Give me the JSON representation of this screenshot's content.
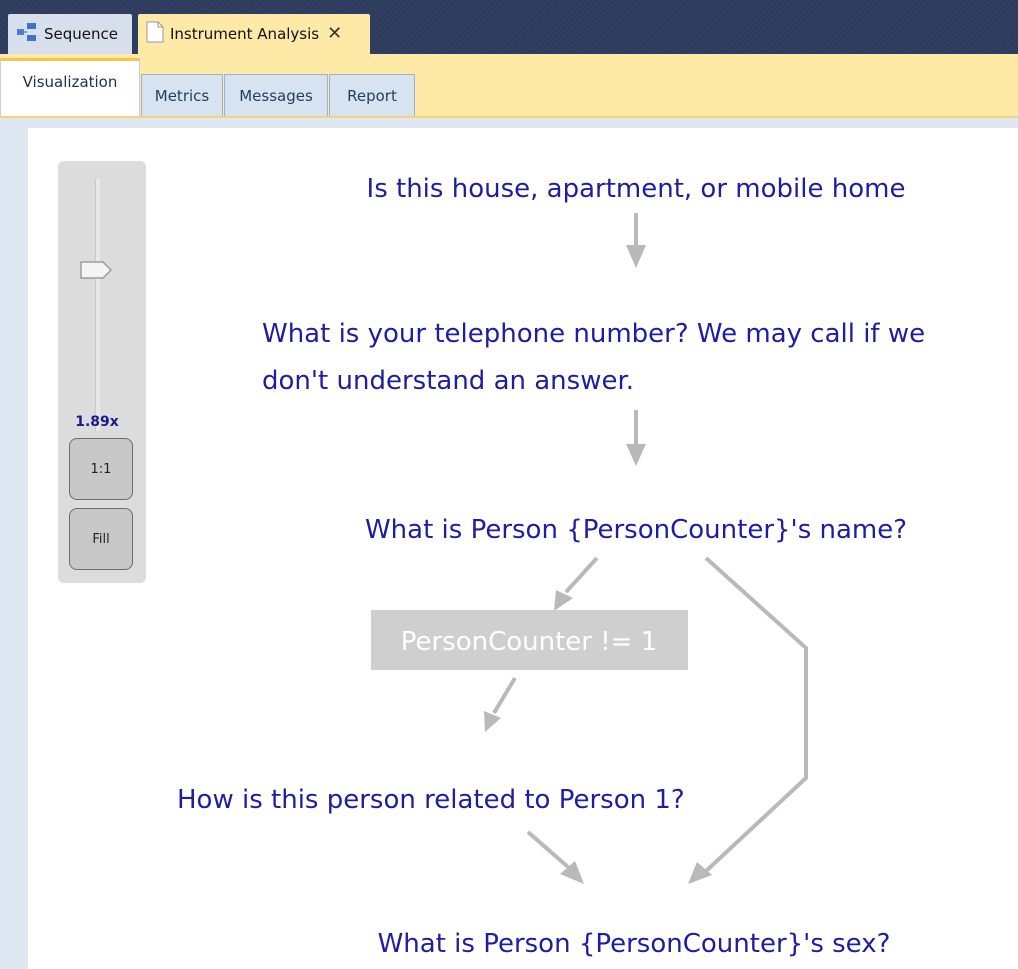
{
  "doc_tabs": [
    {
      "label": "Sequence",
      "icon": "sequence-icon",
      "active": false
    },
    {
      "label": "Instrument Analysis",
      "icon": "document-icon",
      "active": true
    }
  ],
  "view_tabs": [
    {
      "label": "Visualization",
      "active": true
    },
    {
      "label": "Metrics",
      "active": false
    },
    {
      "label": "Messages",
      "active": false
    },
    {
      "label": "Report",
      "active": false
    }
  ],
  "zoom": {
    "readout": "1.89x",
    "one_to_one_label": "1:1",
    "fill_label": "Fill"
  },
  "flow": {
    "q1": "Is this house, apartment, or mobile home",
    "q2_line1": "What is your telephone number? We may call if we",
    "q2_line2": "don't understand an answer.",
    "q3": "What is Person {PersonCounter}'s name?",
    "condition": "PersonCounter != 1",
    "q4": "How is this person related to Person 1?",
    "q5": "What is Person {PersonCounter}'s sex?"
  },
  "colors": {
    "question_text": "#1e1ea0",
    "arrow": "#b9b9b9",
    "active_tab": "#ffe9a6",
    "tabbar_bg": "#2d3b5e"
  }
}
